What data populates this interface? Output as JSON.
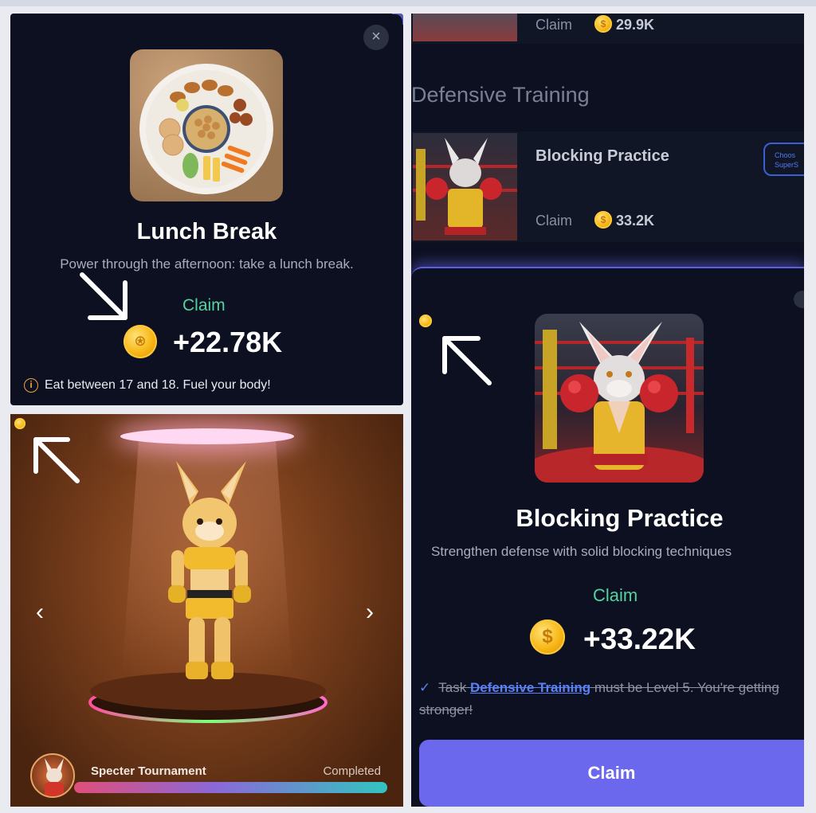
{
  "lunch_card": {
    "close_glyph": "×",
    "title": "Lunch Break",
    "description": "Power through the afternoon: take a lunch break.",
    "claim_label": "Claim",
    "amount": "+22.78K",
    "info_glyph": "i",
    "info_text": "Eat between 17 and 18. Fuel your body!"
  },
  "character_view": {
    "prev_glyph": "‹",
    "next_glyph": "›",
    "tournament_name": "Specter Tournament",
    "status": "Completed",
    "progress": 1.0
  },
  "task_list": {
    "top_row": {
      "claim_label": "Claim",
      "amount": "29.9K"
    },
    "section_title": "Defensive Training",
    "card": {
      "title": "Blocking Practice",
      "choose_line1": "Choos",
      "choose_line2": "SuperS",
      "claim_label": "Claim",
      "amount": "33.2K"
    }
  },
  "blocking_sheet": {
    "title": "Blocking Practice",
    "description": "Strengthen defense with solid blocking techniques",
    "claim_label": "Claim",
    "coin_symbol": "$",
    "amount": "+33.22K",
    "task_prefix": "Task",
    "task_link": "Defensive Training",
    "task_suffix": "must be Level 5. You're getting stronger!",
    "claim_button": "Claim"
  },
  "colors": {
    "panel_bg": "#0c1020",
    "claim_green": "#52d3a0",
    "accent_purple": "#6c68ee",
    "link_blue": "#5b82f5",
    "coin_gold": "#f7b614"
  }
}
